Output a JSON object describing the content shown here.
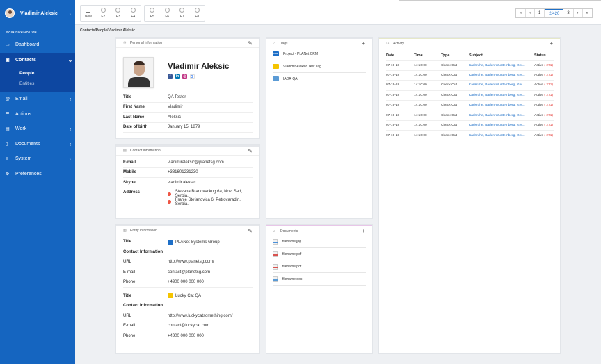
{
  "sidebar": {
    "user_name": "Vladimir Aleksic",
    "heading": "MAIN NAVIGATION",
    "items": {
      "dashboard": "Dashboard",
      "contacts": "Contacts",
      "email": "Email",
      "actions": "Actions",
      "work": "Work",
      "documents": "Documents",
      "system": "System",
      "preferences": "Preferences"
    },
    "contacts_sub": {
      "people": "People",
      "entities": "Entities"
    }
  },
  "toolbar": {
    "fkeys_group1": [
      "New",
      "F2",
      "F3",
      "F4"
    ],
    "fkeys_group2": [
      "F5",
      "F6",
      "F7",
      "F8"
    ]
  },
  "pager": {
    "first": "«",
    "prev": "‹",
    "p1": "1",
    "current": "2/420",
    "p3": "3",
    "next": "›",
    "last": "»"
  },
  "breadcrumb": "Contacts/People/Vladimir Aleksic",
  "personal": {
    "title": "Personal Information",
    "name": "Vladimir Aleksic",
    "fields": [
      {
        "k": "Title",
        "v": "QA Tester"
      },
      {
        "k": "First Name",
        "v": "Vladimir"
      },
      {
        "k": "Last Name",
        "v": "Aleksic"
      },
      {
        "k": "Date of birth",
        "v": "January 15, 1879"
      }
    ]
  },
  "contact": {
    "title": "Contact Information",
    "email_label": "E-mail",
    "email": "vladimiraleksic@planetsg.com",
    "mobile_label": "Mobile",
    "mobile": "+381601231230",
    "skype_label": "Skype",
    "skype": "vladimir.aleksic",
    "address_label": "Address",
    "addresses": [
      "Stevana Branovackog 6a, Novi Sad, Serbia.",
      "Franje Stefanovica 6, Petrovaradin, Serbia."
    ]
  },
  "entity": {
    "title": "Entity Information",
    "entities": [
      {
        "title_label": "Title",
        "name": "PLANet Systems Group",
        "ci": "Contact Information",
        "url_label": "URL",
        "url": "http://www.planetsg.com/",
        "email_label": "E-mail",
        "email": "contact@planetsg.com",
        "phone_label": "Phone",
        "phone": "+4900 000 000 000"
      },
      {
        "title_label": "Title",
        "name": "Lucky Cat QA",
        "ci": "Contact Information",
        "url_label": "URL",
        "url": "http://www.luckycatsomething.com/",
        "email_label": "E-mail",
        "email": "contact@luckycat.com",
        "phone_label": "Phone",
        "phone": "+4900 000 000 000"
      }
    ]
  },
  "tags": {
    "title": "Tags",
    "items": [
      "Project - PLANet CRM",
      "Vladimir Aleksic Test Tag",
      "IADR QA"
    ],
    "icon_texts": [
      "CRM",
      "",
      ""
    ]
  },
  "documents": {
    "title": "Documents",
    "items": [
      "filename.jpg",
      "filename.pdf",
      "filename.pdf",
      "filename.doc"
    ]
  },
  "activity": {
    "title": "Activity",
    "columns": [
      "Date",
      "Time",
      "Type",
      "Subject",
      "Status"
    ],
    "rows": [
      [
        "07-19-18",
        "14:10:00",
        "Check-Out",
        "Karlsruhe, Baden-Wurttemberg, Ger...",
        "Active",
        "( 271)"
      ],
      [
        "07-19-18",
        "14:10:00",
        "Check-Out",
        "Karlsruhe, Baden-Wurttemberg, Ger...",
        "Active",
        "( 271)"
      ],
      [
        "07-19-18",
        "14:10:00",
        "Check-Out",
        "Karlsruhe, Baden-Wurttemberg, Ger...",
        "Active",
        "( 271)"
      ],
      [
        "07-19-18",
        "14:10:00",
        "Check-Out",
        "Karlsruhe, Baden-Wurttemberg, Ger...",
        "Active",
        "( 271)"
      ],
      [
        "07-19-18",
        "14:10:00",
        "Check-Out",
        "Karlsruhe, Baden-Wurttemberg, Ger...",
        "Active",
        "( 271)"
      ],
      [
        "07-19-18",
        "14:10:00",
        "Check-Out",
        "Karlsruhe, Baden-Wurttemberg, Ger...",
        "Active",
        "( 271)"
      ],
      [
        "07-19-18",
        "14:10:00",
        "Check-Out",
        "Karlsruhe, Baden-Wurttemberg, Ger...",
        "Active",
        "( 271)"
      ],
      [
        "07-19-18",
        "14:10:00",
        "Check-Out",
        "Karlsruhe, Baden-Wurttemberg, Ger...",
        "Active",
        "( 271)"
      ]
    ]
  },
  "colors": {
    "sidebar": "#1565c0",
    "sidebar_active": "#0d47a1",
    "link": "#1e6fc7",
    "ticket": "#e53935"
  }
}
